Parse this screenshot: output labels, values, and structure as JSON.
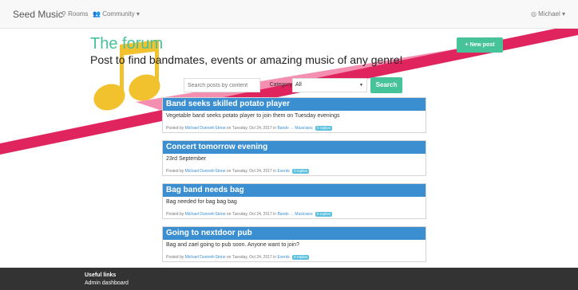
{
  "navbar": {
    "brand": "Seed Music",
    "rooms": "Rooms",
    "community": "Community",
    "user": "Michael"
  },
  "hero": {
    "title": "The forum",
    "subtitle": "Post to find bandmates, events or amazing music of any genre!",
    "new_post": "New post"
  },
  "search": {
    "placeholder": "Search posts by content",
    "category_label": "Category",
    "category_value": "All",
    "button": "Search"
  },
  "posts": [
    {
      "title": "Band seeks skilled potato player",
      "body": "Vegetable band seeks potato player to join them on Tuesday evenings",
      "posted_by": "Posted by",
      "author": "Michael Dunnett-Stone",
      "date": "on Tuesday, Oct 24, 2017 in",
      "category": "Bands → Musicians",
      "replies": "0 replies"
    },
    {
      "title": "Concert tomorrow evening",
      "body": "23rd September",
      "posted_by": "Posted by",
      "author": "Michael Dunnett-Stone",
      "date": "on Tuesday, Oct 24, 2017 in",
      "category": "Events",
      "replies": "0 replies"
    },
    {
      "title": "Bag band needs bag",
      "body": "Bag needed for bag bag bag",
      "posted_by": "Posted by",
      "author": "Michael Dunnett-Stone",
      "date": "on Tuesday, Oct 24, 2017 in",
      "category": "Bands → Musicians",
      "replies": "0 replies"
    },
    {
      "title": "Going to nextdoor pub",
      "body": "Bag and zael going to pub soon. Anyone want to join?",
      "posted_by": "Posted by",
      "author": "Michael Dunnett-Stone",
      "date": "on Tuesday, Oct 24, 2017 in",
      "category": "Events",
      "replies": "0 replies"
    }
  ],
  "footer": {
    "title": "Useful links",
    "link": "Admin dashboard"
  },
  "icons": {
    "rooms": "map-pin-icon",
    "community": "people-icon",
    "user": "user-icon",
    "new_post": "plus-icon",
    "dropdown": "caret-down-icon",
    "decor": "music-note-icon"
  },
  "colors": {
    "accent": "#47c39a",
    "post_header": "#3b8fd1",
    "stripe_dark": "#e0245e",
    "stripe_light": "#f48fb1",
    "note": "#f2c12e",
    "footer_bg": "#333333"
  }
}
